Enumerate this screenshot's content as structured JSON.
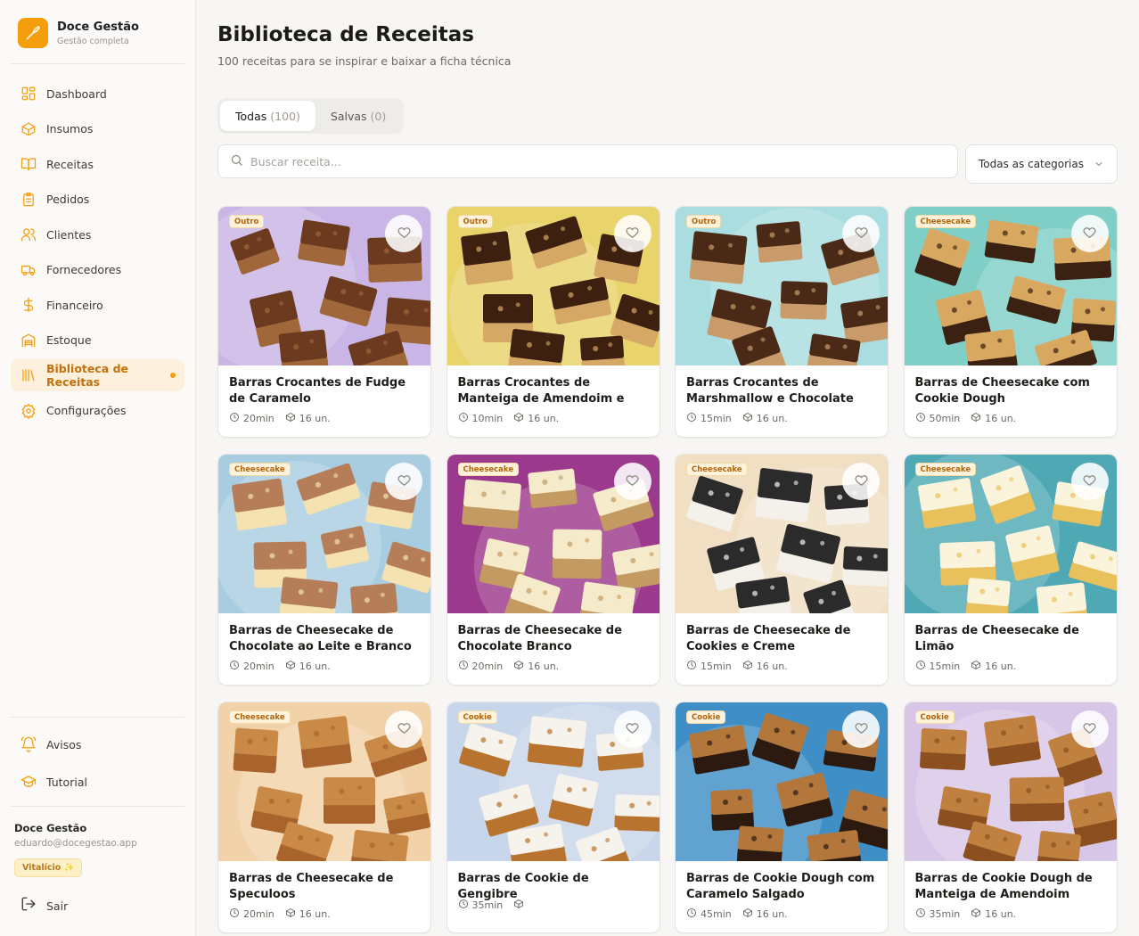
{
  "app": {
    "name": "Doce Gestão",
    "tagline": "Gestão completa"
  },
  "nav": {
    "items": [
      {
        "label": "Dashboard",
        "icon": "layout-grid-icon"
      },
      {
        "label": "Insumos",
        "icon": "box-icon"
      },
      {
        "label": "Receitas",
        "icon": "book-open-icon"
      },
      {
        "label": "Pedidos",
        "icon": "clipboard-icon"
      },
      {
        "label": "Clientes",
        "icon": "users-icon"
      },
      {
        "label": "Fornecedores",
        "icon": "truck-icon"
      },
      {
        "label": "Financeiro",
        "icon": "dollar-icon"
      },
      {
        "label": "Estoque",
        "icon": "warehouse-icon"
      },
      {
        "label": "Biblioteca de Receitas",
        "icon": "library-icon",
        "active": true
      },
      {
        "label": "Configurações",
        "icon": "gear-icon"
      }
    ],
    "bottom": [
      {
        "label": "Avisos",
        "icon": "bell-icon"
      },
      {
        "label": "Tutorial",
        "icon": "graduation-cap-icon"
      }
    ]
  },
  "user": {
    "name": "Doce Gestão",
    "email": "eduardo@docegestao.app",
    "plan": "Vitalício ✨"
  },
  "logout_label": "Sair",
  "page": {
    "title": "Biblioteca de Receitas",
    "subtitle": "100 receitas para se inspirar e baixar a ficha técnica"
  },
  "tabs": [
    {
      "label": "Todas",
      "count": "(100)",
      "active": true
    },
    {
      "label": "Salvas",
      "count": "(0)",
      "active": false
    }
  ],
  "search": {
    "placeholder": "Buscar receita..."
  },
  "category_filter": {
    "selected": "Todas as categorias"
  },
  "accent_color": "#f59e0b",
  "recipes": [
    {
      "category": "Outro",
      "title": "Barras Crocantes de Fudge de Caramelo",
      "time": "20min",
      "yield": "16 un.",
      "palette": [
        "#c9b5e6",
        "#6b3a1f",
        "#a0673a"
      ]
    },
    {
      "category": "Outro",
      "title": "Barras Crocantes de Manteiga de Amendoim e Chocolate",
      "time": "10min",
      "yield": "16 un.",
      "palette": [
        "#e8d46a",
        "#3d2010",
        "#d6a866"
      ]
    },
    {
      "category": "Outro",
      "title": "Barras Crocantes de Marshmallow e Chocolate",
      "time": "15min",
      "yield": "16 un.",
      "palette": [
        "#a9dde0",
        "#4a2a16",
        "#c99a6a"
      ]
    },
    {
      "category": "Cheesecake",
      "title": "Barras de Cheesecake com Cookie Dough",
      "time": "50min",
      "yield": "16 un.",
      "palette": [
        "#7fcfc7",
        "#d9a860",
        "#3a2112"
      ]
    },
    {
      "category": "Cheesecake",
      "title": "Barras de Cheesecake de Chocolate ao Leite e Branco",
      "time": "20min",
      "yield": "16 un.",
      "palette": [
        "#a9cde0",
        "#b57d58",
        "#f4e2b0"
      ]
    },
    {
      "category": "Cheesecake",
      "title": "Barras de Cheesecake de Chocolate Branco",
      "time": "20min",
      "yield": "16 un.",
      "palette": [
        "#9b3a8c",
        "#f5eac9",
        "#c39a61"
      ]
    },
    {
      "category": "Cheesecake",
      "title": "Barras de Cheesecake de Cookies e Creme",
      "time": "15min",
      "yield": "16 un.",
      "palette": [
        "#f1dfc4",
        "#2b2b2b",
        "#f4f1ea"
      ]
    },
    {
      "category": "Cheesecake",
      "title": "Barras de Cheesecake de Limão",
      "time": "15min",
      "yield": "16 un.",
      "palette": [
        "#4fa9b5",
        "#fbf4dd",
        "#e9c15c"
      ]
    },
    {
      "category": "Cheesecake",
      "title": "Barras de Cheesecake de Speculoos",
      "time": "20min",
      "yield": "16 un.",
      "palette": [
        "#f2d2a8",
        "#c98a47",
        "#a8642c"
      ]
    },
    {
      "category": "Cookie",
      "title": "Barras de Cookie de Gengibre",
      "time": "35min",
      "yield": "",
      "palette": [
        "#c7d6ea",
        "#f6f2ec",
        "#b8742e"
      ]
    },
    {
      "category": "Cookie",
      "title": "Barras de Cookie Dough com Caramelo Salgado",
      "time": "45min",
      "yield": "16 un.",
      "palette": [
        "#3f8fc6",
        "#b3773c",
        "#2c1a10"
      ]
    },
    {
      "category": "Cookie",
      "title": "Barras de Cookie Dough de Manteiga de Amendoim com...",
      "time": "35min",
      "yield": "16 un.",
      "palette": [
        "#d8c6e8",
        "#c0803f",
        "#8c5020"
      ]
    }
  ]
}
